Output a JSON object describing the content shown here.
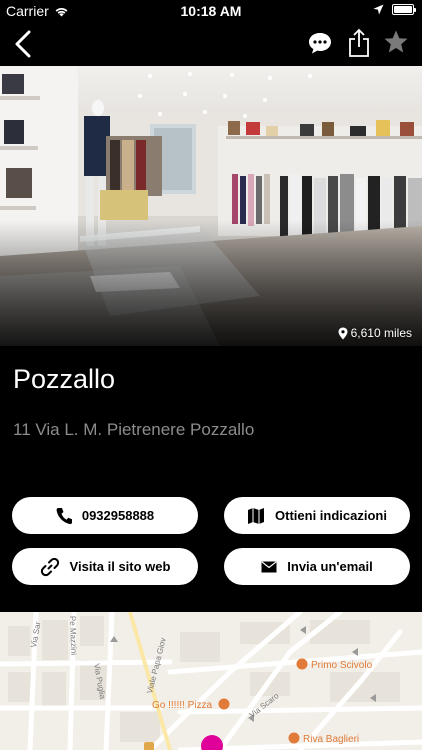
{
  "status_bar": {
    "carrier": "Carrier",
    "time": "10:18 AM"
  },
  "nav": {
    "icons": [
      "back-chevron-icon",
      "chat-bubble-icon",
      "share-icon",
      "star-icon"
    ]
  },
  "hero": {
    "distance": "6,610 miles",
    "icon": "location-pin-icon"
  },
  "store": {
    "name": "Pozzallo",
    "address": "11 Via L. M. Pietrenere Pozzallo"
  },
  "actions": {
    "call_label": "0932958888",
    "directions_label": "Ottieni indicazioni",
    "website_label": "Visita il sito web",
    "email_label": "Invia un'email"
  },
  "map": {
    "street_labels": [
      "Via Sar",
      "Viale Papa Giov",
      "Via Puglia",
      "Pe Mazzini",
      "Via Scaro"
    ],
    "poi_labels": [
      "Primo Scivolo",
      "Go !!!!!! Pizza",
      "Riva Baglieri"
    ],
    "accent_color": "#e0009a",
    "poi_color": "#e07b39"
  }
}
